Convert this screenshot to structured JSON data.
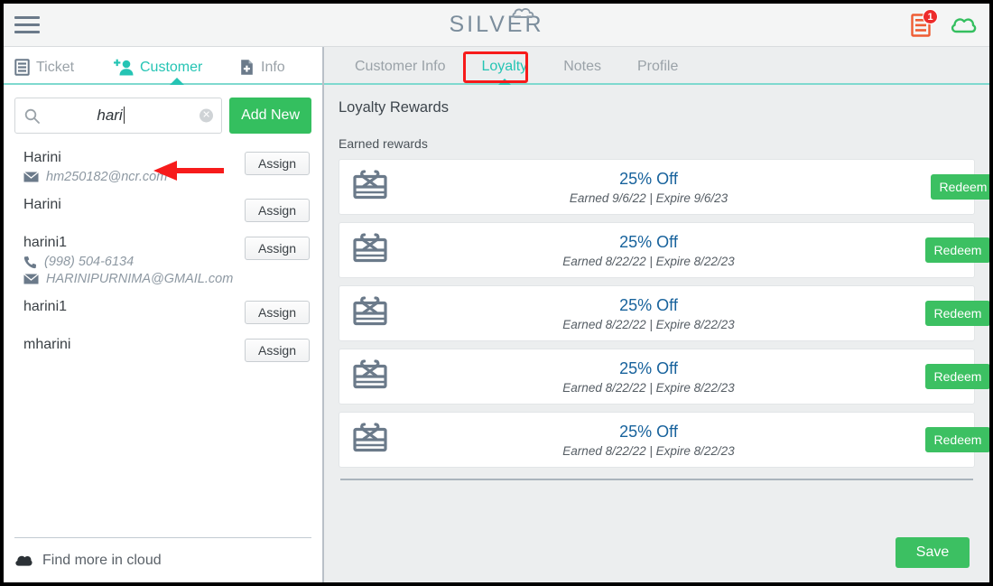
{
  "header": {
    "menu_icon": "hamburger-menu-icon",
    "logo_text": "SILVER",
    "logo_cloud_icon": "cloud-icon",
    "receipt_icon": "receipt-icon",
    "receipt_badge_count": "1",
    "cloud_status_icon": "cloud-icon",
    "badge_color": "#ed2b2b",
    "receipt_color": "#ef5c33",
    "cloud_color": "#34bf5f"
  },
  "left_panel": {
    "tabs": [
      {
        "label": "Ticket",
        "icon": "receipt-icon",
        "active": false
      },
      {
        "label": "Customer",
        "icon": "add-person-icon",
        "active": true
      },
      {
        "label": "Info",
        "icon": "document-add-icon",
        "active": false
      }
    ],
    "search": {
      "icon": "search-icon",
      "value": "hari",
      "placeholder": "Search",
      "clear_icon": "clear-circle-icon"
    },
    "add_new_label": "Add New",
    "customers": [
      {
        "name": "Harini",
        "details": [
          {
            "icon": "envelope-icon",
            "text": "hm250182@ncr.com"
          }
        ],
        "action_label": "Assign"
      },
      {
        "name": "Harini",
        "details": [],
        "action_label": "Assign"
      },
      {
        "name": "harini1",
        "details": [
          {
            "icon": "phone-icon",
            "text": "(998) 504-6134"
          },
          {
            "icon": "envelope-icon",
            "text": "HARINIPURNIMA@GMAIL.com"
          }
        ],
        "action_label": "Assign"
      },
      {
        "name": "harini1",
        "details": [],
        "action_label": "Assign"
      },
      {
        "name": "mharini",
        "details": [],
        "action_label": "Assign"
      }
    ],
    "footer": {
      "icon": "cloud-icon",
      "label": "Find more in cloud"
    },
    "annotation": {
      "type": "red-arrow-left",
      "color": "#f71b1b"
    }
  },
  "right_panel": {
    "tabs": [
      {
        "label": "Customer Info",
        "active": false
      },
      {
        "label": "Loyalty",
        "active": true,
        "highlighted": true
      },
      {
        "label": "Notes",
        "active": false
      },
      {
        "label": "Profile",
        "active": false
      }
    ],
    "title": "Loyalty Rewards",
    "section_label": "Earned rewards",
    "rewards": [
      {
        "icon": "gift-card-icon",
        "amount": "25% Off",
        "dates": "Earned 9/6/22 | Expire 9/6/23",
        "action_label": "Redeem"
      },
      {
        "icon": "gift-card-icon",
        "amount": "25% Off",
        "dates": "Earned 8/22/22 | Expire 8/22/23",
        "action_label": "Redeem"
      },
      {
        "icon": "gift-card-icon",
        "amount": "25% Off",
        "dates": "Earned 8/22/22 | Expire 8/22/23",
        "action_label": "Redeem"
      },
      {
        "icon": "gift-card-icon",
        "amount": "25% Off",
        "dates": "Earned 8/22/22 | Expire 8/22/23",
        "action_label": "Redeem"
      },
      {
        "icon": "gift-card-icon",
        "amount": "25% Off",
        "dates": "Earned 8/22/22 | Expire 8/22/23",
        "action_label": "Redeem"
      }
    ],
    "save_label": "Save",
    "annotation": {
      "type": "red-rectangle-on-loyalty-tab",
      "color": "#f71b1b"
    }
  },
  "colors": {
    "accent_teal": "#25c4b4",
    "green_button": "#3cc062",
    "add_new_green": "#34bf5f",
    "reward_blue": "#17629c",
    "annotation_red": "#f71b1b",
    "icon_slate": "#6b7a8a"
  }
}
